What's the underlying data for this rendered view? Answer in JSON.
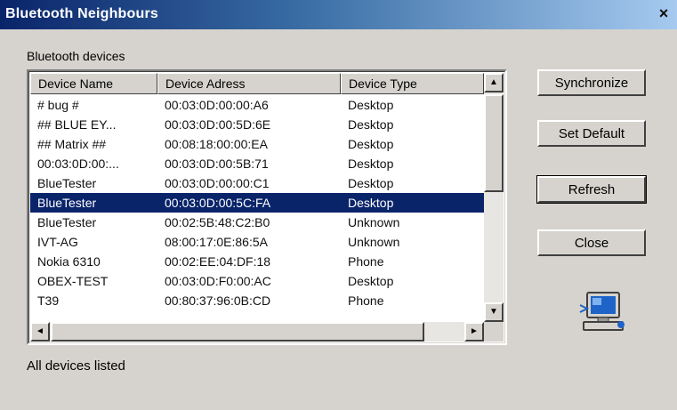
{
  "window": {
    "title": "Bluetooth Neighbours",
    "close_glyph": "×"
  },
  "group": {
    "label": "Bluetooth devices"
  },
  "table": {
    "columns": [
      "Device Name",
      "Device Adress",
      "Device Type"
    ],
    "rows": [
      {
        "name": "# bug #",
        "address": "00:03:0D:00:00:A6",
        "type": "Desktop"
      },
      {
        "name": "## BLUE EY...",
        "address": "00:03:0D:00:5D:6E",
        "type": "Desktop"
      },
      {
        "name": "## Matrix ##",
        "address": "00:08:18:00:00:EA",
        "type": "Desktop"
      },
      {
        "name": "00:03:0D:00:...",
        "address": "00:03:0D:00:5B:71",
        "type": "Desktop"
      },
      {
        "name": "BlueTester",
        "address": "00:03:0D:00:00:C1",
        "type": "Desktop"
      },
      {
        "name": "BlueTester",
        "address": "00:03:0D:00:5C:FA",
        "type": "Desktop"
      },
      {
        "name": "BlueTester",
        "address": "00:02:5B:48:C2:B0",
        "type": "Unknown"
      },
      {
        "name": "IVT-AG",
        "address": "08:00:17:0E:86:5A",
        "type": "Unknown"
      },
      {
        "name": "Nokia 6310",
        "address": "00:02:EE:04:DF:18",
        "type": "Phone"
      },
      {
        "name": "OBEX-TEST",
        "address": "00:03:0D:F0:00:AC",
        "type": "Desktop"
      },
      {
        "name": "T39",
        "address": "00:80:37:96:0B:CD",
        "type": "Phone"
      }
    ],
    "selected_row": 5,
    "scroll_arrows": {
      "up": "▲",
      "down": "▼",
      "left": "◄",
      "right": "►"
    }
  },
  "buttons": {
    "synchronize": "Synchronize",
    "set_default": "Set Default",
    "refresh": "Refresh",
    "close": "Close"
  },
  "status": {
    "text": "All devices listed"
  },
  "icons": {
    "device": "computer-bluetooth-icon"
  },
  "colors": {
    "title_start": "#0a246a",
    "title_end": "#a6caf0",
    "selection": "#0a246a",
    "face": "#d6d3ce"
  }
}
